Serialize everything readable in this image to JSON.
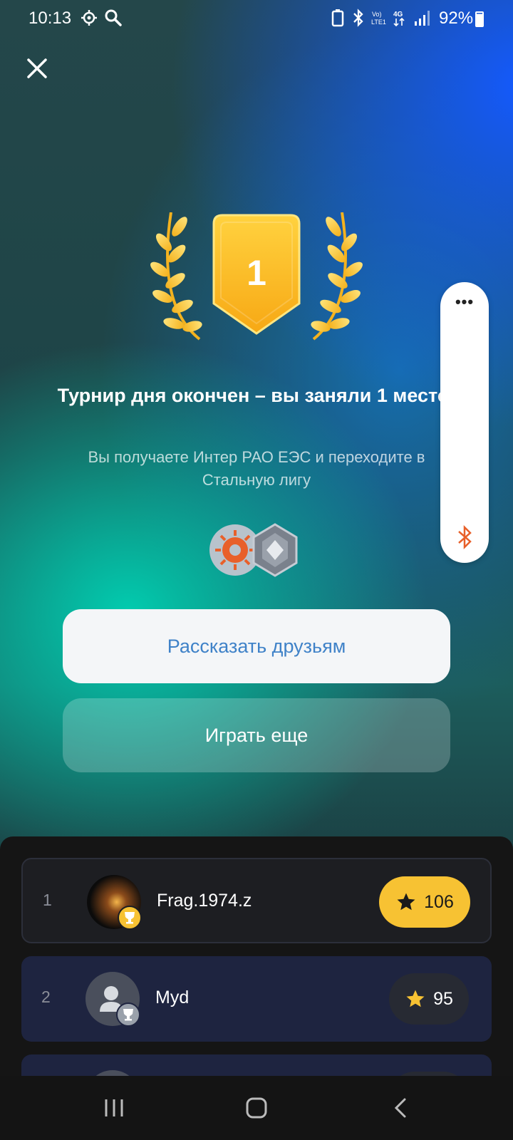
{
  "status_bar": {
    "time": "10:13",
    "battery": "92%",
    "network": "4G"
  },
  "result": {
    "place": "1",
    "title": "Турнир дня окончен – вы заняли 1 место!",
    "subtitle": "Вы получаете Интер РАО ЕЭС и переходите в Стальную лигу"
  },
  "buttons": {
    "share": "Рассказать друзьям",
    "play_again": "Играть еще"
  },
  "leaderboard": [
    {
      "rank": "1",
      "name": "Frag.1974.z",
      "score": "106"
    },
    {
      "rank": "2",
      "name": "Myd",
      "score": "95"
    }
  ],
  "colors": {
    "accent_gold": "#f7c233",
    "share_text": "#3f82c8"
  }
}
